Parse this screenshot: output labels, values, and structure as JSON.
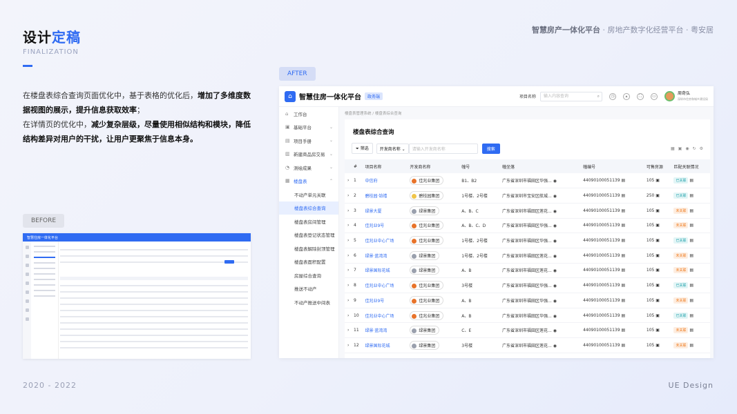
{
  "page": {
    "title_a": "设计",
    "title_b": "定稿",
    "subtitle": "FINALIZATION",
    "brand_bold": "智慧房产一体化平台",
    "brand_rest": "· 房地产数字化经营平台 · 粤安居",
    "desc_1": "在楼盘表综合查询页面优化中，基于表格的优化后，",
    "desc_1b": "增加了多维度数据视图的展示，提升信息获取效率",
    "desc_1c": "；",
    "desc_2": "在详情页的优化中，",
    "desc_2b": "减少复杂层级，尽量使用相似结构和模块，降低结构差异对用户的干扰，让用户更聚焦于信息本身。",
    "before_label": "BEFORE",
    "after_label": "AFTER",
    "years": "2020 - 2022",
    "footer": "UE Design",
    "accent": "#2f6bf2"
  },
  "app": {
    "name": "智慧住房一体化平台",
    "badge": "政务端",
    "project_label": "项目名称",
    "search_placeholder": "输入内容查询",
    "user_name": "周奇弘",
    "user_org": "深圳市住房和城乡建设局",
    "menu": [
      {
        "icon": "⌂",
        "label": "工作台"
      },
      {
        "icon": "▣",
        "label": "基础平台",
        "arrow": "⌄"
      },
      {
        "icon": "▤",
        "label": "项目手册",
        "arrow": "⌄"
      },
      {
        "icon": "▥",
        "label": "新建商品房交易",
        "arrow": "⌄"
      },
      {
        "icon": "◔",
        "label": "测绘成果",
        "arrow": "⌄"
      },
      {
        "icon": "▦",
        "label": "楼盘表",
        "arrow": "⌃"
      }
    ],
    "submenu": [
      "不动产单元关联",
      "楼盘表综合查询",
      "楼盘表房间管理",
      "楼盘表登记状态管理",
      "楼盘表解除封顶管理",
      "楼盘表面积配置",
      "房屋综合查询",
      "推送不动产",
      "不动产推送中间表"
    ],
    "breadcrumb": "楼盘表管理系统 / 楼盘表综合查询",
    "page_title": "楼盘表综合查询",
    "filter_label": "筛选",
    "filter_select": "开发商名称",
    "filter_input": "请输入开发商名称",
    "search_btn": "搜索",
    "columns": [
      "#",
      "项目名称",
      "开发商名称",
      "幢号",
      "幢坐落",
      "幢编号",
      "可售房源",
      "匹配关联情况"
    ],
    "rows": [
      [
        "1",
        "中信府",
        "佳兆业集团",
        "B1、B2",
        "广东省深圳市福田区华强...",
        "44090100051139",
        "105",
        "已关联",
        "#e8732a"
      ],
      [
        "2",
        "碧桂园·铂禧",
        "碧桂园集团",
        "1号楼、2号楼",
        "广东省深圳市宝安区航城...",
        "44090100051139",
        "250",
        "已关联",
        "#f0c54a"
      ],
      [
        "3",
        "绿景大厦",
        "绿景集团",
        "A、B、C",
        "广东省深圳市福田区莲花...",
        "44090100051139",
        "105",
        "未关联",
        "#9aa0ad"
      ],
      [
        "4",
        "佳兆业9号",
        "佳兆业集团",
        "A、B、C、D",
        "广东省深圳市福田区华强...",
        "44090100051139",
        "105",
        "未关联",
        "#e8732a"
      ],
      [
        "5",
        "佳兆业中心广场",
        "佳兆业集团",
        "1号楼、2号楼",
        "广东省深圳市福田区华强...",
        "44090100051139",
        "105",
        "已关联",
        "#e8732a"
      ],
      [
        "6",
        "绿景·蓝湾湾",
        "绿景集团",
        "1号楼、2号楼",
        "广东省深圳市福田区莲花...",
        "44090100051139",
        "105",
        "未关联",
        "#9aa0ad"
      ],
      [
        "7",
        "绿景国际花城",
        "绿景集团",
        "A、B",
        "广东省深圳市福田区莲花...",
        "44090100051139",
        "105",
        "未关联",
        "#9aa0ad"
      ],
      [
        "8",
        "佳兆业中心广场",
        "佳兆业集团",
        "3号楼",
        "广东省深圳市福田区华强...",
        "44090100051139",
        "105",
        "已关联",
        "#e8732a"
      ],
      [
        "9",
        "佳兆业9号",
        "佳兆业集团",
        "A、B",
        "广东省深圳市福田区华强...",
        "44090100051139",
        "105",
        "未关联",
        "#e8732a"
      ],
      [
        "10",
        "佳兆业中心广场",
        "佳兆业集团",
        "A、B",
        "广东省深圳市福田区华强...",
        "44090100051139",
        "105",
        "已关联",
        "#e8732a"
      ],
      [
        "11",
        "绿景·蓝湾湾",
        "绿景集团",
        "C、E",
        "广东省深圳市福田区莲花...",
        "44090100051139",
        "105",
        "未关联",
        "#9aa0ad"
      ],
      [
        "12",
        "绿景国际花城",
        "绿景集团",
        "3号楼",
        "广东省深圳市福田区莲花...",
        "44090100051139",
        "105",
        "未关联",
        "#9aa0ad"
      ]
    ]
  }
}
